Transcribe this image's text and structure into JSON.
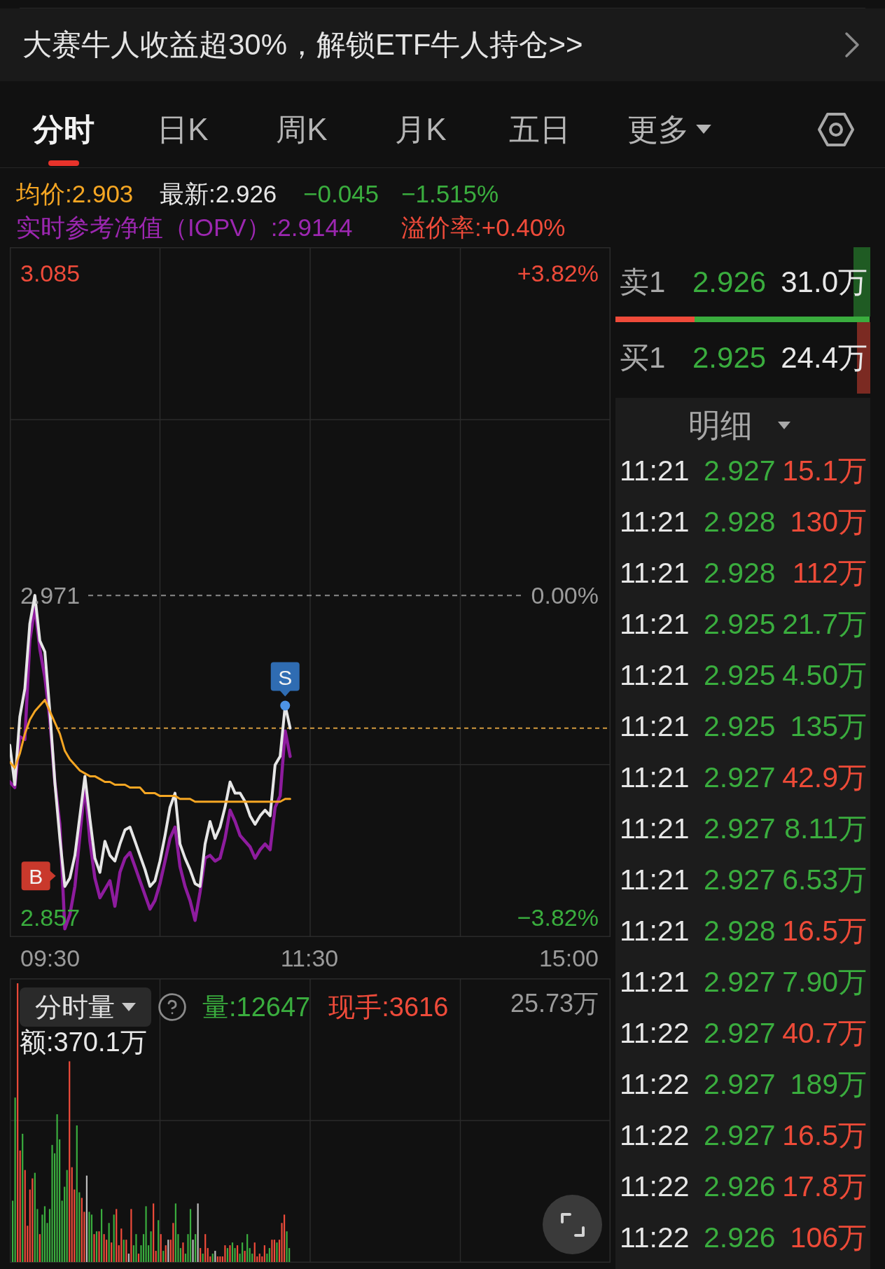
{
  "banner": {
    "text": "大赛牛人收益超30%，解锁ETF牛人持仓>>"
  },
  "tabs": [
    {
      "label": "分时",
      "selected": true,
      "kind": "view"
    },
    {
      "label": "日K",
      "selected": false,
      "kind": "view"
    },
    {
      "label": "周K",
      "selected": false,
      "kind": "view"
    },
    {
      "label": "月K",
      "selected": false,
      "kind": "view"
    },
    {
      "label": "五日",
      "selected": false,
      "kind": "view"
    },
    {
      "label": "更多",
      "selected": false,
      "kind": "menu"
    }
  ],
  "quote": {
    "average": "均价:2.903",
    "latest": "最新:2.926",
    "change": "−0.045",
    "change_percent": "−1.515%",
    "iopv": "实时参考净值（IOPV）:2.9144",
    "premium": "溢价率:+0.40%"
  },
  "price_chart": {
    "percent_labels": [
      "+3.82%",
      "0.00%",
      "−3.82%"
    ],
    "chart_data": {
      "type": "line",
      "categories": [
        null,
        null,
        null,
        null,
        null,
        null,
        null,
        null,
        null,
        null,
        null,
        null,
        null,
        null,
        null,
        null,
        null,
        null,
        null,
        null,
        null,
        null,
        null,
        null,
        null,
        null,
        null,
        null,
        null,
        null,
        null,
        null,
        null,
        null,
        null,
        null,
        null,
        null,
        null,
        null,
        null,
        null,
        null,
        null,
        null,
        null,
        null,
        null,
        null,
        null,
        null,
        null,
        null,
        null,
        null,
        null,
        null,
        null,
        null,
        null,
        null,
        null,
        null,
        null,
        null,
        null,
        null,
        null,
        null,
        null,
        null,
        null,
        null,
        null,
        null,
        null,
        null,
        null,
        null,
        null,
        null,
        null,
        null,
        null,
        null,
        null,
        null,
        null,
        null,
        null,
        null,
        null,
        null,
        null,
        null,
        null,
        null,
        null,
        null,
        null,
        null,
        null,
        null,
        null,
        null,
        null,
        null,
        null,
        null,
        null,
        null,
        null,
        null,
        null,
        null,
        null,
        null,
        null,
        null,
        null,
        null
      ],
      "series": [
        {
          "color": "#8e1c9e",
          "values": [
            2.905,
            2.903,
            2.921,
            2.92,
            2.955,
            2.967,
            2.952,
            2.942,
            2.927,
            2.905,
            2.89,
            2.853,
            2.858,
            2.868,
            2.886,
            2.904,
            2.884,
            2.871,
            2.864,
            2.867,
            2.87,
            2.861,
            2.873,
            2.878,
            2.88,
            2.875,
            2.87,
            2.865,
            2.86,
            2.863,
            2.869,
            2.877,
            2.885,
            2.889,
            2.875,
            2.868,
            2.863,
            2.856,
            2.866,
            2.878,
            2.879,
            2.877,
            2.878,
            2.885,
            2.895,
            2.891,
            2.886,
            2.884,
            2.882,
            2.878,
            2.881,
            2.883,
            2.881,
            2.896,
            2.9,
            2.923,
            2.914,
            null,
            null,
            null,
            null,
            null,
            null,
            null,
            null,
            null,
            null,
            null,
            null,
            null,
            null,
            null,
            null,
            null,
            null,
            null,
            null,
            null,
            null,
            null,
            null,
            null,
            null,
            null,
            null,
            null,
            null,
            null,
            null,
            null,
            null,
            null,
            null,
            null,
            null,
            null,
            null,
            null,
            null,
            null,
            null,
            null,
            null,
            null,
            null,
            null,
            null,
            null,
            null,
            null,
            null,
            null,
            null,
            null,
            null,
            null,
            null,
            null,
            null,
            null,
            null
          ]
        },
        {
          "color": "#e6e6e6",
          "values": [
            2.918,
            2.904,
            2.928,
            2.938,
            2.961,
            2.971,
            2.955,
            2.951,
            2.93,
            2.905,
            2.885,
            2.868,
            2.871,
            2.879,
            2.893,
            2.907,
            2.892,
            2.878,
            2.873,
            2.884,
            2.879,
            2.877,
            2.883,
            2.888,
            2.889,
            2.884,
            2.879,
            2.874,
            2.868,
            2.87,
            2.877,
            2.886,
            2.896,
            2.901,
            2.883,
            2.878,
            2.874,
            2.869,
            2.868,
            2.883,
            2.891,
            2.885,
            2.889,
            2.896,
            2.905,
            2.901,
            2.901,
            2.898,
            2.893,
            2.89,
            2.893,
            2.895,
            2.893,
            2.911,
            2.914,
            2.932,
            2.924,
            null,
            null,
            null,
            null,
            null,
            null,
            null,
            null,
            null,
            null,
            null,
            null,
            null,
            null,
            null,
            null,
            null,
            null,
            null,
            null,
            null,
            null,
            null,
            null,
            null,
            null,
            null,
            null,
            null,
            null,
            null,
            null,
            null,
            null,
            null,
            null,
            null,
            null,
            null,
            null,
            null,
            null,
            null,
            null,
            null,
            null,
            null,
            null,
            null,
            null,
            null,
            null,
            null,
            null,
            null,
            null,
            null,
            null,
            null,
            null,
            null,
            null,
            null,
            null
          ]
        },
        {
          "color": "#f5a623",
          "values": [
            2.912,
            2.91,
            2.915,
            2.922,
            2.927,
            2.93,
            2.932,
            2.934,
            2.93,
            2.926,
            2.922,
            2.916,
            2.913,
            2.911,
            2.909,
            2.908,
            2.907,
            2.907,
            2.906,
            2.905,
            2.905,
            2.904,
            2.904,
            2.904,
            2.903,
            2.903,
            2.903,
            2.901,
            2.901,
            2.901,
            2.9,
            2.9,
            2.9,
            2.9,
            2.899,
            2.899,
            2.899,
            2.898,
            2.898,
            2.898,
            2.898,
            2.898,
            2.898,
            2.898,
            2.898,
            2.898,
            2.898,
            2.898,
            2.898,
            2.898,
            2.898,
            2.898,
            2.898,
            2.898,
            2.898,
            2.899,
            2.899,
            null,
            null,
            null,
            null,
            null,
            null,
            null,
            null,
            null,
            null,
            null,
            null,
            null,
            null,
            null,
            null,
            null,
            null,
            null,
            null,
            null,
            null,
            null,
            null,
            null,
            null,
            null,
            null,
            null,
            null,
            null,
            null,
            null,
            null,
            null,
            null,
            null,
            null,
            null,
            null,
            null,
            null,
            null,
            null,
            null,
            null,
            null,
            null,
            null,
            null,
            null,
            null,
            null,
            null,
            null,
            null,
            null,
            null,
            null,
            null,
            null,
            null,
            null,
            null
          ]
        }
      ],
      "ylim": [
        2.8501,
        3.0942
      ],
      "yticks": [
        {
          "value": 3.085,
          "label": "3.085"
        },
        {
          "value": 2.971,
          "label": "2.971"
        },
        {
          "value": 2.857,
          "label": "2.857"
        }
      ],
      "ref_lines": [
        {
          "axis": "y",
          "value": 2.971
        },
        {
          "axis": "y",
          "value": 2.924
        }
      ],
      "annotations": [
        "B",
        "S"
      ]
    },
    "time_labels": [
      "09:30",
      "11:30",
      "15:00"
    ]
  },
  "volume_panel": {
    "selector": "分时量",
    "volume": "量:12647",
    "current_hand": "现手:3616",
    "max_label": "25.73万",
    "amount": "额:370.1万"
  },
  "order_book": {
    "rows": [
      {
        "kind": "sell",
        "label": "卖1",
        "price": "2.926",
        "volume": "31.0万",
        "level": 0.066
      },
      {
        "kind": "buy",
        "label": "买1",
        "price": "2.925",
        "volume": "24.4万",
        "level": 0.052
      }
    ],
    "ratio_bar": {
      "level": 0.31
    }
  },
  "trade_details": {
    "title": "明细",
    "rows": [
      {
        "time": "11:21",
        "price": "2.927",
        "volume": "15.1万",
        "color": "#ee4b38"
      },
      {
        "time": "11:21",
        "price": "2.928",
        "volume": "130万",
        "color": "#ee4b38"
      },
      {
        "time": "11:21",
        "price": "2.928",
        "volume": "112万",
        "color": "#ee4b38"
      },
      {
        "time": "11:21",
        "price": "2.925",
        "volume": "21.7万",
        "color": "#3aad3e"
      },
      {
        "time": "11:21",
        "price": "2.925",
        "volume": "4.50万",
        "color": "#3aad3e"
      },
      {
        "time": "11:21",
        "price": "2.925",
        "volume": "135万",
        "color": "#3aad3e"
      },
      {
        "time": "11:21",
        "price": "2.927",
        "volume": "42.9万",
        "color": "#ee4b38"
      },
      {
        "time": "11:21",
        "price": "2.927",
        "volume": "8.11万",
        "color": "#3aad3e"
      },
      {
        "time": "11:21",
        "price": "2.927",
        "volume": "6.53万",
        "color": "#3aad3e"
      },
      {
        "time": "11:21",
        "price": "2.928",
        "volume": "16.5万",
        "color": "#ee4b38"
      },
      {
        "time": "11:21",
        "price": "2.927",
        "volume": "7.90万",
        "color": "#3aad3e"
      },
      {
        "time": "11:22",
        "price": "2.927",
        "volume": "40.7万",
        "color": "#ee4b38"
      },
      {
        "time": "11:22",
        "price": "2.927",
        "volume": "189万",
        "color": "#3aad3e"
      },
      {
        "time": "11:22",
        "price": "2.927",
        "volume": "16.5万",
        "color": "#ee4b38"
      },
      {
        "time": "11:22",
        "price": "2.926",
        "volume": "17.8万",
        "color": "#ee4b38"
      },
      {
        "time": "11:22",
        "price": "2.926",
        "volume": "106万",
        "color": "#ee4b38"
      }
    ]
  }
}
